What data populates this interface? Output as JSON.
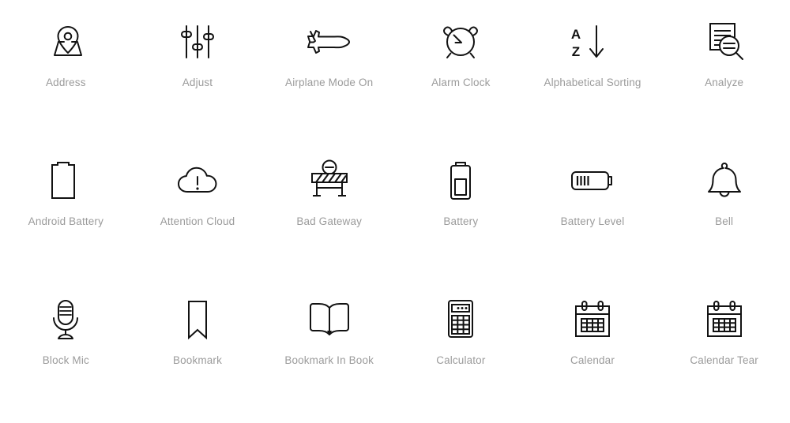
{
  "page": {
    "title": "Icon Set Grid",
    "background_color": "#ffffff",
    "icon_color": "#121212",
    "label_color": "#9b9b9b",
    "columns": 6,
    "rows": 3
  },
  "icons": [
    {
      "label": "Address",
      "icon_name": "address-icon"
    },
    {
      "label": "Adjust",
      "icon_name": "adjust-icon"
    },
    {
      "label": "Airplane Mode On",
      "icon_name": "airplane-mode-on-icon"
    },
    {
      "label": "Alarm Clock",
      "icon_name": "alarm-clock-icon"
    },
    {
      "label": "Alphabetical Sorting",
      "icon_name": "alphabetical-sorting-icon"
    },
    {
      "label": "Analyze",
      "icon_name": "analyze-icon"
    },
    {
      "label": "Android Battery",
      "icon_name": "android-battery-icon"
    },
    {
      "label": "Attention Cloud",
      "icon_name": "attention-cloud-icon"
    },
    {
      "label": "Bad Gateway",
      "icon_name": "bad-gateway-icon"
    },
    {
      "label": "Battery",
      "icon_name": "battery-icon"
    },
    {
      "label": "Battery Level",
      "icon_name": "battery-level-icon"
    },
    {
      "label": "Bell",
      "icon_name": "bell-icon"
    },
    {
      "label": "Block Mic",
      "icon_name": "block-mic-icon"
    },
    {
      "label": "Bookmark",
      "icon_name": "bookmark-icon"
    },
    {
      "label": "Bookmark In Book",
      "icon_name": "bookmark-in-book-icon"
    },
    {
      "label": "Calculator",
      "icon_name": "calculator-icon"
    },
    {
      "label": "Calendar",
      "icon_name": "calendar-icon"
    },
    {
      "label": "Calendar Tear",
      "icon_name": "calendar-tear-icon"
    }
  ],
  "alphabetical_sorting_letters": {
    "top": "A",
    "bottom": "Z"
  }
}
